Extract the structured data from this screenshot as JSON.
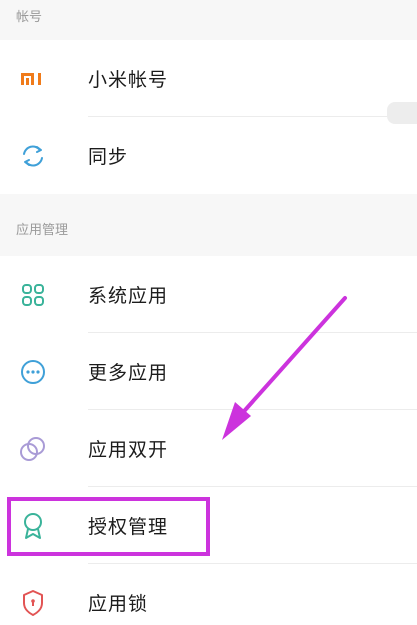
{
  "sections": {
    "account": {
      "header": "帐号",
      "items": [
        {
          "label": "小米帐号",
          "icon": "mi-logo-icon"
        },
        {
          "label": "同步",
          "icon": "sync-icon"
        }
      ]
    },
    "apps": {
      "header": "应用管理",
      "items": [
        {
          "label": "系统应用",
          "icon": "grid-icon"
        },
        {
          "label": "更多应用",
          "icon": "more-dots-icon"
        },
        {
          "label": "应用双开",
          "icon": "dual-circles-icon"
        },
        {
          "label": "授权管理",
          "icon": "badge-icon"
        },
        {
          "label": "应用锁",
          "icon": "shield-lock-icon"
        }
      ]
    }
  },
  "colors": {
    "mi_orange": "#f07b1a",
    "icon_blue": "#3fa0d8",
    "icon_green": "#3ab39a",
    "icon_purple": "#a99bd6",
    "icon_red": "#e25454",
    "annotation_magenta": "#cc33dd"
  }
}
